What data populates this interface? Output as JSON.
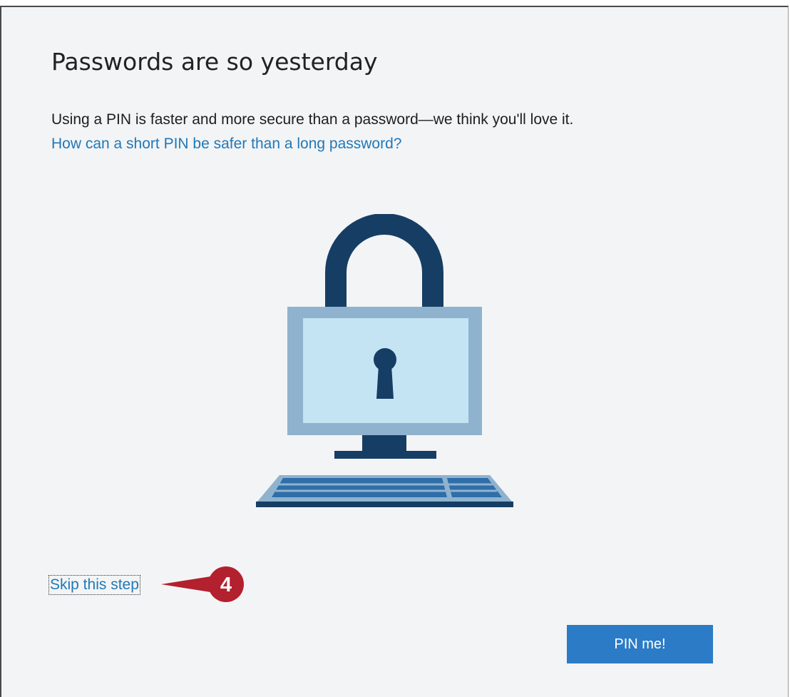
{
  "dialog": {
    "title": "Passwords are so yesterday",
    "description": "Using a PIN is faster and more secure than a password—we think you'll love it.",
    "help_link": "How can a short PIN be safer than a long password?",
    "skip_link": "Skip this step",
    "pin_button": "PIN me!"
  },
  "illustration": {
    "icon": "padlock-computer-icon"
  },
  "callout": {
    "number": "4",
    "color": "#b3202e"
  },
  "colors": {
    "link": "#1f78b8",
    "button": "#2b7bc6",
    "dark_navy": "#163e64",
    "screen_frame": "#8fb3cf",
    "screen_fill": "#c4e4f4"
  }
}
